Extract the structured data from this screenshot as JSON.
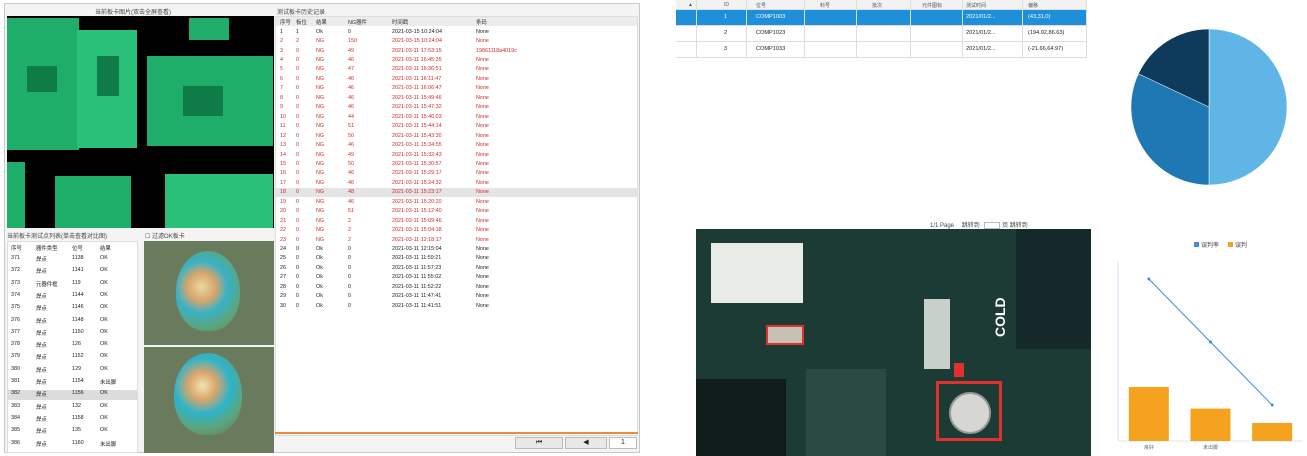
{
  "left": {
    "image_title": "当前板卡图片(双击全屏查看)",
    "history_title": "测试板卡历史记录",
    "history_headers": [
      "序号",
      "板位",
      "结果",
      "NG器件",
      "时间戳",
      "条码"
    ],
    "history": [
      [
        "1",
        "1",
        "Ok",
        "0",
        "2021-03-15 10:24:04",
        "None"
      ],
      [
        "2",
        "2",
        "NG",
        "150",
        "2021-03-15 10:24:04",
        "None"
      ],
      [
        "3",
        "0",
        "NG",
        "49",
        "2021-03-11 17:53:15",
        "19861118a4019c"
      ],
      [
        "4",
        "0",
        "NG",
        "46",
        "2021-03-11 16:45:35",
        "None"
      ],
      [
        "5",
        "0",
        "NG",
        "47",
        "2021-03-11 16:36:51",
        "None"
      ],
      [
        "6",
        "0",
        "NG",
        "46",
        "2021-03-11 16:11:47",
        "None"
      ],
      [
        "7",
        "0",
        "NG",
        "46",
        "2021-03-11 16:06:47",
        "None"
      ],
      [
        "8",
        "0",
        "NG",
        "46",
        "2021-03-11 15:49:46",
        "None"
      ],
      [
        "9",
        "0",
        "NG",
        "46",
        "2021-03-11 15:47:32",
        "None"
      ],
      [
        "10",
        "0",
        "NG",
        "44",
        "2021-03-11 15:46:03",
        "None"
      ],
      [
        "11",
        "0",
        "NG",
        "51",
        "2021-03-11 15:44:14",
        "None"
      ],
      [
        "12",
        "0",
        "NG",
        "50",
        "2021-03-11 15:43:30",
        "None"
      ],
      [
        "13",
        "0",
        "NG",
        "46",
        "2021-03-11 15:34:55",
        "None"
      ],
      [
        "14",
        "0",
        "NG",
        "49",
        "2021-03-11 15:32:43",
        "None"
      ],
      [
        "15",
        "0",
        "NG",
        "50",
        "2021-03-11 15:30:57",
        "None"
      ],
      [
        "16",
        "0",
        "NG",
        "46",
        "2021-03-11 15:29:17",
        "None"
      ],
      [
        "17",
        "0",
        "NG",
        "46",
        "2021-03-11 15:24:32",
        "None"
      ],
      [
        "18",
        "0",
        "NG",
        "48",
        "2021-03-11 15:23:17",
        "None"
      ],
      [
        "19",
        "0",
        "NG",
        "46",
        "2021-03-11 15:20:20",
        "None"
      ],
      [
        "20",
        "0",
        "NG",
        "51",
        "2021-03-11 15:12:40",
        "None"
      ],
      [
        "21",
        "0",
        "NG",
        "2",
        "2021-03-11 15:09:46",
        "None"
      ],
      [
        "22",
        "0",
        "NG",
        "2",
        "2021-03-11 15:04:18",
        "None"
      ],
      [
        "23",
        "0",
        "NG",
        "2",
        "2021-03-11 12:18:17",
        "None"
      ],
      [
        "24",
        "0",
        "Ok",
        "0",
        "2021-03-11 12:15:04",
        "None"
      ],
      [
        "25",
        "0",
        "Ok",
        "0",
        "2021-03-11 11:59:21",
        "None"
      ],
      [
        "26",
        "0",
        "Ok",
        "0",
        "2021-03-11 11:57:23",
        "None"
      ],
      [
        "27",
        "0",
        "Ok",
        "0",
        "2021-03-11 11:55:02",
        "None"
      ],
      [
        "28",
        "0",
        "Ok",
        "0",
        "2021-03-11 11:52:22",
        "None"
      ],
      [
        "29",
        "0",
        "Ok",
        "0",
        "2021-03-11 11:47:41",
        "None"
      ],
      [
        "30",
        "0",
        "Ok",
        "0",
        "2021-03-11 11:41:51",
        "None"
      ]
    ],
    "points_title": "当前板卡测试点列表(单击查看对比图)",
    "filter_label": "过滤OK板卡",
    "points_headers": [
      "序号",
      "器件类型",
      "位号",
      "结果"
    ],
    "points": [
      [
        "371",
        "焊点",
        "1138",
        "OK"
      ],
      [
        "372",
        "焊点",
        "1141",
        "OK"
      ],
      [
        "373",
        "元器件框",
        "119",
        "OK"
      ],
      [
        "374",
        "焊点",
        "1144",
        "OK"
      ],
      [
        "375",
        "焊点",
        "1146",
        "OK"
      ],
      [
        "376",
        "焊点",
        "1148",
        "OK"
      ],
      [
        "377",
        "焊点",
        "1150",
        "OK"
      ],
      [
        "378",
        "焊点",
        "126",
        "OK"
      ],
      [
        "379",
        "焊点",
        "1152",
        "OK"
      ],
      [
        "380",
        "焊点",
        "129",
        "OK"
      ],
      [
        "381",
        "焊点",
        "1154",
        "未出脚"
      ],
      [
        "382",
        "焊点",
        "1156",
        "OK"
      ],
      [
        "383",
        "焊点",
        "132",
        "OK"
      ],
      [
        "384",
        "焊点",
        "1158",
        "OK"
      ],
      [
        "385",
        "焊点",
        "135",
        "OK"
      ],
      [
        "386",
        "焊点",
        "1160",
        "未出脚"
      ]
    ],
    "page_first": "⏮",
    "page_prev": "◀",
    "page_num": "1"
  },
  "right": {
    "table_headers": [
      "ID",
      "位号",
      "料号",
      "批次",
      "元件图标",
      "测试时间",
      "偏移"
    ],
    "rows": [
      [
        "1",
        "COMP1003",
        "",
        "",
        "",
        "2021/01/2...",
        "(43,31,0)"
      ],
      [
        "2",
        "COMP1023",
        "",
        "",
        "",
        "2021/01/2...",
        "(194.92,86.63)"
      ],
      [
        "3",
        "COMP1033",
        "",
        "",
        "",
        "2021/01/2...",
        "(-21.66,64.97)"
      ]
    ],
    "pager_text": "1/1 Page",
    "pager_jump": "跳转到",
    "pager_page": "页",
    "pager_go": "跳转到",
    "cold_label": "COLD"
  },
  "colors": {
    "ng": "#d42a2a",
    "select": "#1e8fd8",
    "pie": [
      "#5fb6e6",
      "#1e78b4",
      "#0e3a5c"
    ],
    "bar": "#f5a21e",
    "line": "#3a8fe0"
  },
  "chart_data": [
    {
      "type": "pie",
      "values": [
        50,
        32,
        18
      ]
    },
    {
      "type": "bar",
      "categories": [
        "良好",
        "未出脚",
        ""
      ],
      "series": [
        {
          "name": "误判率",
          "type": "line",
          "values": [
            90,
            55,
            20
          ]
        },
        {
          "name": "误判",
          "values": [
            30,
            18,
            10
          ]
        }
      ]
    }
  ]
}
